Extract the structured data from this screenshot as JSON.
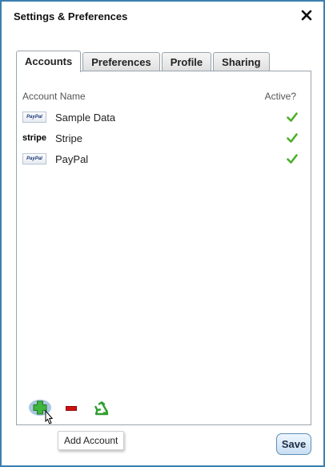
{
  "dialog": {
    "title": "Settings & Preferences",
    "close_icon": "close-icon"
  },
  "tabs": [
    {
      "label": "Accounts",
      "active": true
    },
    {
      "label": "Preferences",
      "active": false
    },
    {
      "label": "Profile",
      "active": false
    },
    {
      "label": "Sharing",
      "active": false
    }
  ],
  "accounts": {
    "columns": {
      "name": "Account Name",
      "active": "Active?"
    },
    "rows": [
      {
        "logo": "PayPal",
        "name": "Sample Data",
        "active": true
      },
      {
        "logo": "stripe",
        "name": "Stripe",
        "active": true
      },
      {
        "logo": "PayPal",
        "name": "PayPal",
        "active": true
      }
    ]
  },
  "toolbar": {
    "add_icon": "plus-icon",
    "remove_icon": "minus-icon",
    "recycle_icon": "recycle-icon",
    "tooltip": "Add Account"
  },
  "footer": {
    "save_label": "Save"
  },
  "colors": {
    "border": "#3c7fb1",
    "check": "#4caf2a",
    "add": "#3fb53f",
    "remove": "#cc1111",
    "recycle": "#2f9e2f"
  }
}
